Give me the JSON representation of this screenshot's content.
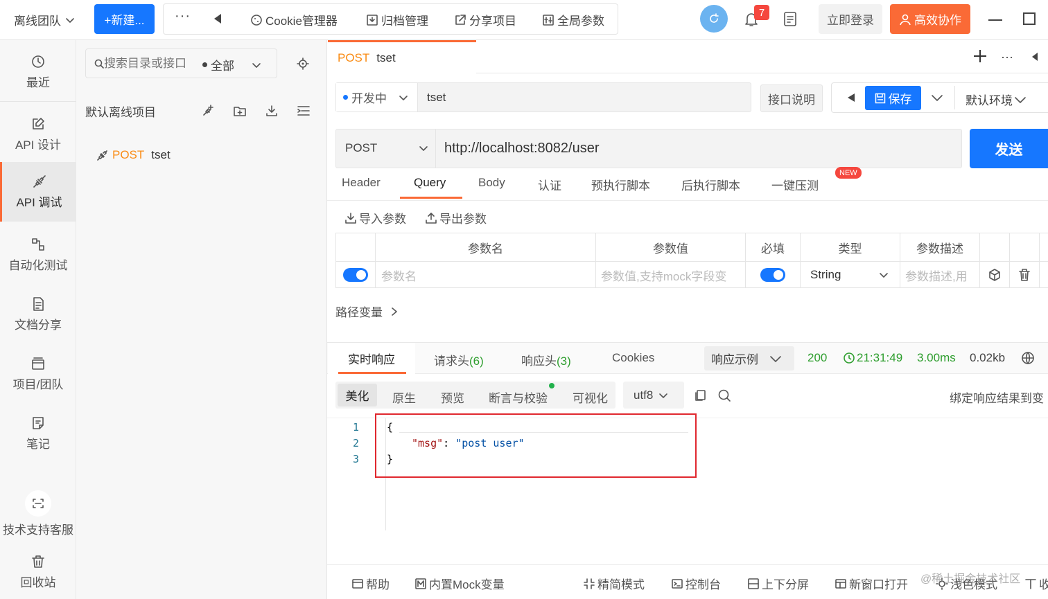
{
  "topbar": {
    "team": "离线团队",
    "new_button": "+新建...",
    "more": "···",
    "cookie_manager": "Cookie管理器",
    "archive_manager": "归档管理",
    "share_project": "分享项目",
    "global_params": "全局参数",
    "notification_count": "7",
    "login": "立即登录",
    "collab": "高效协作"
  },
  "rail": {
    "items": [
      {
        "label": "最近"
      },
      {
        "label": "API 设计"
      },
      {
        "label": "API 调试"
      },
      {
        "label": "自动化测试"
      },
      {
        "label": "文档分享"
      },
      {
        "label": "项目/团队"
      },
      {
        "label": "笔记"
      },
      {
        "label": "技术支持客服"
      },
      {
        "label": "回收站"
      }
    ]
  },
  "tree": {
    "search_placeholder": "搜索目录或接口",
    "filter": "全部",
    "project_name": "默认离线项目",
    "api_method": "POST",
    "api_name": "tset"
  },
  "request_tab": {
    "method": "POST",
    "name": "tset"
  },
  "request": {
    "status": "开发中",
    "name_value": "tset",
    "doc_button": "接口说明",
    "save_button": "保存",
    "env": "默认环境",
    "method": "POST",
    "url": "http://localhost:8082/user",
    "send_button": "发送"
  },
  "param_tabs": [
    "Header",
    "Query",
    "Body",
    "认证",
    "预执行脚本",
    "后执行脚本",
    "一键压测"
  ],
  "new_badge": "NEW",
  "param_actions": {
    "import": "导入参数",
    "export": "导出参数"
  },
  "params_table": {
    "headers": [
      "参数名",
      "参数值",
      "必填",
      "类型",
      "参数描述"
    ],
    "row": {
      "name_placeholder": "参数名",
      "value_placeholder": "参数值,支持mock字段变",
      "type": "String",
      "desc_placeholder": "参数描述,用"
    }
  },
  "path_vars": "路径变量",
  "response_tabs": {
    "realtime": "实时响应",
    "req_headers": "请求头",
    "req_headers_count": "(6)",
    "resp_headers": "响应头",
    "resp_headers_count": "(3)",
    "cookies": "Cookies",
    "example": "响应示例"
  },
  "response_meta": {
    "status": "200",
    "time": "21:31:49",
    "duration": "3.00ms",
    "size": "0.02kb"
  },
  "view_tabs": [
    "美化",
    "原生",
    "预览",
    "断言与校验",
    "可视化"
  ],
  "encoding": "utf8",
  "bind_result": "绑定响应结果到变",
  "code": {
    "line_numbers": [
      "1",
      "2",
      "3"
    ],
    "open_brace": "{",
    "key": "\"msg\"",
    "colon": ": ",
    "value": "\"post user\"",
    "close_brace": "}"
  },
  "footer": {
    "help": "帮助",
    "mock": "内置Mock变量",
    "simple": "精简模式",
    "console": "控制台",
    "split": "上下分屏",
    "new_window": "新窗口打开",
    "light": "浅色模式",
    "collapse": "收缩",
    "watermark": "@稀土掘金技术社区"
  },
  "colors": {
    "accent": "#1677ff",
    "orange": "#fa6a36",
    "green": "#2e9e2e",
    "highlight_box": "#e0272e"
  }
}
